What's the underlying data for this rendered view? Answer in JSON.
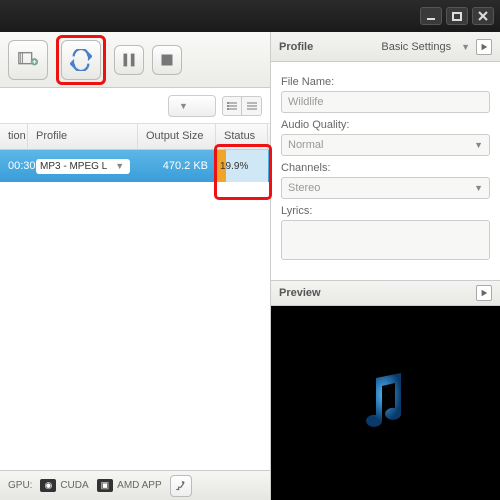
{
  "window": {
    "minimize": "–",
    "maximize": "□",
    "close": "✕"
  },
  "table": {
    "headers": {
      "time": "tion",
      "profile": "Profile",
      "size": "Output Size",
      "status": "Status"
    },
    "row": {
      "time": "00:30",
      "profile": "MP3 - MPEG L",
      "size": "470.2 KB",
      "status_percent": "19.9%"
    }
  },
  "status": {
    "gpu_label": "GPU:",
    "cuda": "CUDA",
    "amd": "AMD APP"
  },
  "panel": {
    "title": "Profile",
    "basic_settings": "Basic Settings",
    "filename_label": "File Name:",
    "filename_value": "Wildlife",
    "audio_quality_label": "Audio Quality:",
    "audio_quality_value": "Normal",
    "channels_label": "Channels:",
    "channels_value": "Stereo",
    "lyrics_label": "Lyrics:",
    "preview_label": "Preview"
  }
}
